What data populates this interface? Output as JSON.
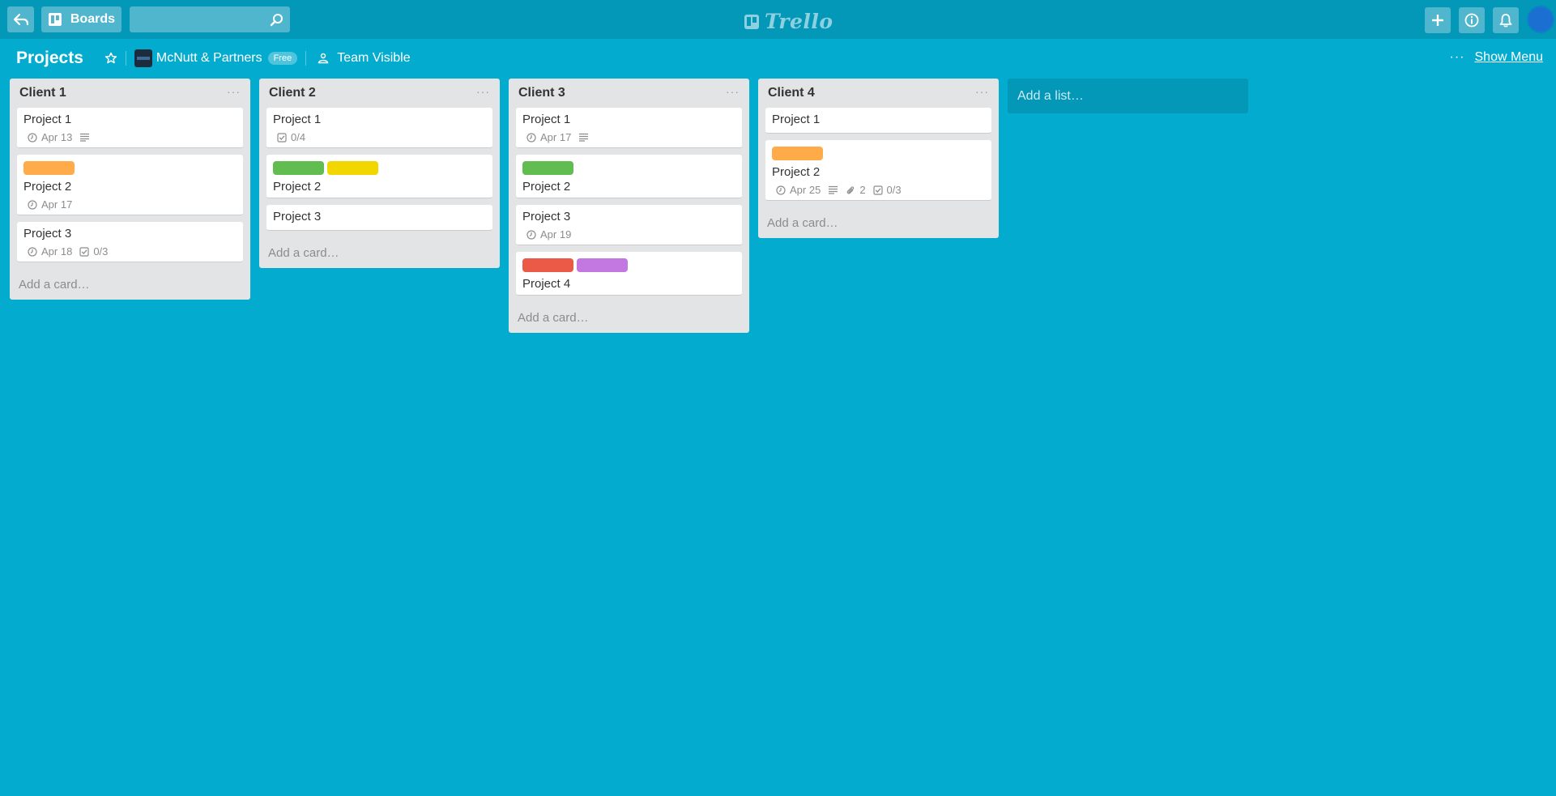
{
  "header": {
    "boards_label": "Boards",
    "search_placeholder": "",
    "logo_text": "Trello"
  },
  "board": {
    "title": "Projects",
    "team_name": "McNutt & Partners",
    "team_plan": "Free",
    "visibility": "Team Visible",
    "menu_dots": "···",
    "show_menu": "Show Menu"
  },
  "colors": {
    "background": "#03acce",
    "header": "#0397b8",
    "orange": "#ffab4a",
    "green": "#61bd4f",
    "yellow": "#f2d600",
    "red": "#eb5a46",
    "purple": "#c377e0"
  },
  "lists": [
    {
      "title": "Client 1",
      "menu": "···",
      "add_card": "Add a card…",
      "cards": [
        {
          "title": "Project 1",
          "labels": [],
          "badges": [
            {
              "icon": "clock-icon",
              "text": "Apr 13"
            },
            {
              "icon": "description-icon",
              "text": ""
            }
          ]
        },
        {
          "title": "Project 2",
          "labels": [
            "orange"
          ],
          "badges": [
            {
              "icon": "clock-icon",
              "text": "Apr 17"
            }
          ]
        },
        {
          "title": "Project 3",
          "labels": [],
          "badges": [
            {
              "icon": "clock-icon",
              "text": "Apr 18"
            },
            {
              "icon": "checklist-icon",
              "text": "0/3"
            }
          ]
        }
      ]
    },
    {
      "title": "Client 2",
      "menu": "···",
      "add_card": "Add a card…",
      "cards": [
        {
          "title": "Project 1",
          "labels": [],
          "badges": [
            {
              "icon": "checklist-icon",
              "text": "0/4"
            }
          ]
        },
        {
          "title": "Project 2",
          "labels": [
            "green",
            "yellow"
          ],
          "badges": []
        },
        {
          "title": "Project 3",
          "labels": [],
          "badges": []
        }
      ]
    },
    {
      "title": "Client 3",
      "menu": "···",
      "add_card": "Add a card…",
      "cards": [
        {
          "title": "Project 1",
          "labels": [],
          "badges": [
            {
              "icon": "clock-icon",
              "text": "Apr 17"
            },
            {
              "icon": "description-icon",
              "text": ""
            }
          ]
        },
        {
          "title": "Project 2",
          "labels": [
            "green"
          ],
          "badges": []
        },
        {
          "title": "Project 3",
          "labels": [],
          "badges": [
            {
              "icon": "clock-icon",
              "text": "Apr 19"
            }
          ]
        },
        {
          "title": "Project 4",
          "labels": [
            "red",
            "purple"
          ],
          "badges": []
        }
      ]
    },
    {
      "title": "Client 4",
      "menu": "···",
      "add_card": "Add a card…",
      "cards": [
        {
          "title": "Project 1",
          "labels": [],
          "badges": []
        },
        {
          "title": "Project 2",
          "labels": [
            "orange"
          ],
          "badges": [
            {
              "icon": "clock-icon",
              "text": "Apr 25"
            },
            {
              "icon": "description-icon",
              "text": ""
            },
            {
              "icon": "attachment-icon",
              "text": "2"
            },
            {
              "icon": "checklist-icon",
              "text": "0/3"
            }
          ]
        }
      ]
    }
  ],
  "add_list": "Add a list…"
}
